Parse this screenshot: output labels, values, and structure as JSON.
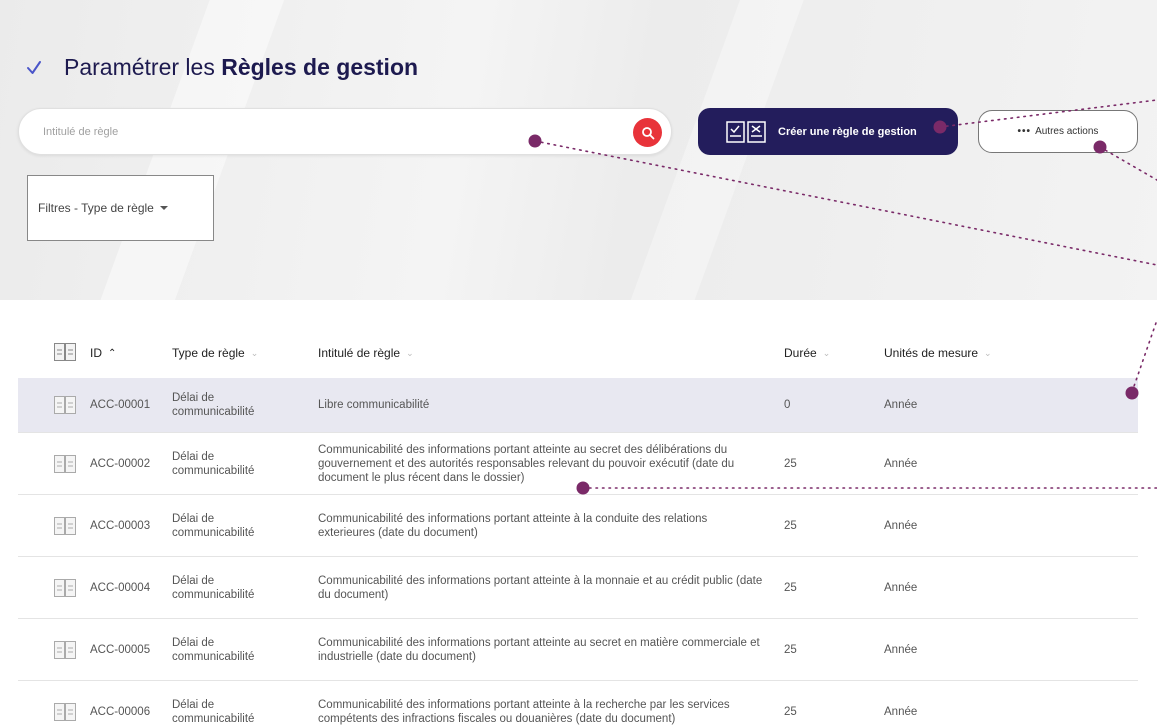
{
  "header": {
    "title_prefix": "Paramétrer les ",
    "title_bold": "Règles de gestion"
  },
  "search": {
    "placeholder": "Intitulé de règle"
  },
  "actions": {
    "create_label": "Créer une règle de gestion",
    "other_label": "Autres actions"
  },
  "filter": {
    "label": "Filtres - Type de règle"
  },
  "table": {
    "columns": {
      "id": "ID",
      "type": "Type de règle",
      "title": "Intitulé de règle",
      "duree": "Durée",
      "unit": "Unités de mesure"
    },
    "rows": [
      {
        "id": "ACC-00001",
        "type": "Délai de communicabilité",
        "title": "Libre communicabilité",
        "duree": "0",
        "unit": "Année"
      },
      {
        "id": "ACC-00002",
        "type": "Délai de communicabilité",
        "title": "Communicabilité des informations portant atteinte au secret des délibérations du gouvernement et des autorités responsables relevant du pouvoir exécutif (date du document le plus récent dans le dossier)",
        "duree": "25",
        "unit": "Année"
      },
      {
        "id": "ACC-00003",
        "type": "Délai de communicabilité",
        "title": "Communicabilité des informations portant atteinte à la conduite des relations exterieures (date du document)",
        "duree": "25",
        "unit": "Année"
      },
      {
        "id": "ACC-00004",
        "type": "Délai de communicabilité",
        "title": "Communicabilité des informations portant atteinte à la monnaie et au crédit public (date du document)",
        "duree": "25",
        "unit": "Année"
      },
      {
        "id": "ACC-00005",
        "type": "Délai de communicabilité",
        "title": "Communicabilité des informations portant atteinte au secret en matière commerciale et industrielle (date du document)",
        "duree": "25",
        "unit": "Année"
      },
      {
        "id": "ACC-00006",
        "type": "Délai de communicabilité",
        "title": "Communicabilité des informations portant atteinte à la recherche par les services compétents des infractions fiscales ou douanières (date du document)",
        "duree": "25",
        "unit": "Année"
      }
    ]
  },
  "colors": {
    "primary": "#231d5c",
    "accent": "#e8333a",
    "row_highlight": "#e8e8f1",
    "callout_dots": "#7a2a68"
  }
}
